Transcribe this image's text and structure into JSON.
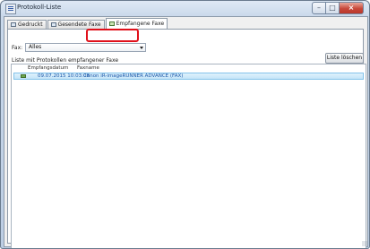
{
  "window": {
    "title": "Protokoll-Liste"
  },
  "tabs": [
    {
      "label": "Gedruckt",
      "icon": "printer-icon"
    },
    {
      "label": "Gesendete Faxe",
      "icon": "sent-fax-icon"
    },
    {
      "label": "Empfangene Faxe",
      "icon": "received-fax-icon",
      "active": true
    }
  ],
  "filter": {
    "label": "Fax:",
    "selected": "Alles"
  },
  "list": {
    "caption": "Liste mit Protokollen empfangener Faxe",
    "clear_button": "Liste löschen",
    "columns": [
      "Empfangsdatum",
      "Faxname"
    ],
    "rows": [
      {
        "date": "09.07.2015 10:03:08",
        "name": "Canon iR-imageRUNNER ADVANCE (FAX)",
        "selected": true
      }
    ]
  },
  "colors": {
    "highlight": "#e0101a",
    "selection": "#cfe9fa"
  }
}
